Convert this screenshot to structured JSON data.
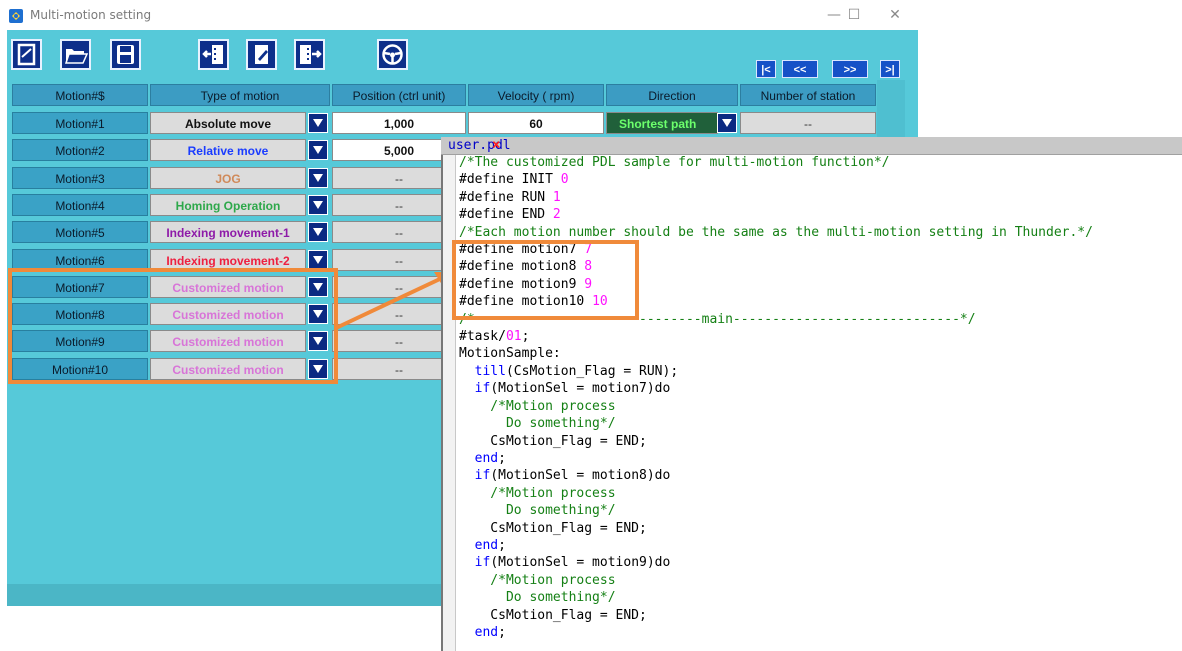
{
  "window": {
    "title": "Multi-motion setting",
    "controls": {
      "minimize": "—",
      "maximize": "☐",
      "close": "✕"
    }
  },
  "toolbar": {
    "icons": [
      "new-file-icon",
      "open-folder-icon",
      "save-icon",
      "import-icon",
      "edit-chip-icon",
      "export-icon",
      "steering-wheel-icon"
    ],
    "nav": {
      "first": "|<",
      "prev": "<<",
      "next": ">>",
      "last": ">|"
    }
  },
  "table": {
    "headers": [
      "Motion#$",
      "Type of motion",
      "Position (ctrl unit)",
      "Velocity ( rpm)",
      "Direction",
      "Number of station"
    ],
    "rows": [
      {
        "motion": "Motion#1",
        "type": "Absolute move",
        "type_color": "#111111",
        "position": "1,000",
        "velocity": "60",
        "direction": "Shortest path",
        "station": "--"
      },
      {
        "motion": "Motion#2",
        "type": "Relative move",
        "type_color": "#1a3cff",
        "position": "5,000"
      },
      {
        "motion": "Motion#3",
        "type": "JOG",
        "type_color": "#d08a5a",
        "position": "--"
      },
      {
        "motion": "Motion#4",
        "type": "Homing Operation",
        "type_color": "#2ea84a",
        "position": "--"
      },
      {
        "motion": "Motion#5",
        "type": "Indexing movement-1",
        "type_color": "#8e1aa8",
        "position": "--"
      },
      {
        "motion": "Motion#6",
        "type": "Indexing movement-2",
        "type_color": "#ee2040",
        "position": "--"
      },
      {
        "motion": "Motion#7",
        "type": "Customized motion",
        "type_color": "#d874d8",
        "position": "--"
      },
      {
        "motion": "Motion#8",
        "type": "Customized motion",
        "type_color": "#d874d8",
        "position": "--"
      },
      {
        "motion": "Motion#9",
        "type": "Customized motion",
        "type_color": "#d874d8",
        "position": "--"
      },
      {
        "motion": "Motion#10",
        "type": "Customized motion",
        "type_color": "#d874d8",
        "position": "--"
      }
    ]
  },
  "editor": {
    "tab_name": "user.pdl",
    "tab_close": "×",
    "lines": [
      [
        {
          "t": "/*The customized PDL sample for multi-motion function*/",
          "c": "cm"
        }
      ],
      [
        {
          "t": "#define INIT ",
          "c": "tx"
        },
        {
          "t": "0",
          "c": "nm"
        }
      ],
      [
        {
          "t": "#define RUN ",
          "c": "tx"
        },
        {
          "t": "1",
          "c": "nm"
        }
      ],
      [
        {
          "t": "#define END ",
          "c": "tx"
        },
        {
          "t": "2",
          "c": "nm"
        }
      ],
      [
        {
          "t": "/*Each motion number should be the same as the multi-motion setting in Thunder.*/",
          "c": "cm"
        }
      ],
      [
        {
          "t": "#define motion7 ",
          "c": "tx"
        },
        {
          "t": "7",
          "c": "nm"
        }
      ],
      [
        {
          "t": "#define motion8 ",
          "c": "tx"
        },
        {
          "t": "8",
          "c": "nm"
        }
      ],
      [
        {
          "t": "#define motion9 ",
          "c": "tx"
        },
        {
          "t": "9",
          "c": "nm"
        }
      ],
      [
        {
          "t": "#define motion10 ",
          "c": "tx"
        },
        {
          "t": "10",
          "c": "nm"
        }
      ],
      [
        {
          "t": "/*-----------------------------main-----------------------------*/",
          "c": "cm"
        }
      ],
      [
        {
          "t": "#task/",
          "c": "tx"
        },
        {
          "t": "01",
          "c": "nm"
        },
        {
          "t": ";",
          "c": "tx"
        }
      ],
      [
        {
          "t": "MotionSample:",
          "c": "tx"
        }
      ],
      [
        {
          "t": "  ",
          "c": "tx"
        },
        {
          "t": "till",
          "c": "kw"
        },
        {
          "t": "(CsMotion_Flag = RUN);",
          "c": "tx"
        }
      ],
      [
        {
          "t": "  ",
          "c": "tx"
        },
        {
          "t": "if",
          "c": "kw"
        },
        {
          "t": "(MotionSel = motion7)do",
          "c": "tx"
        }
      ],
      [
        {
          "t": "    /*Motion process",
          "c": "cm"
        }
      ],
      [
        {
          "t": "      Do something*/",
          "c": "cm"
        }
      ],
      [
        {
          "t": "    CsMotion_Flag = END;",
          "c": "tx"
        }
      ],
      [
        {
          "t": "  end",
          "c": "kw"
        },
        {
          "t": ";",
          "c": "tx"
        }
      ],
      [
        {
          "t": "  ",
          "c": "tx"
        },
        {
          "t": "if",
          "c": "kw"
        },
        {
          "t": "(MotionSel = motion8)do",
          "c": "tx"
        }
      ],
      [
        {
          "t": "    /*Motion process",
          "c": "cm"
        }
      ],
      [
        {
          "t": "      Do something*/",
          "c": "cm"
        }
      ],
      [
        {
          "t": "    CsMotion_Flag = END;",
          "c": "tx"
        }
      ],
      [
        {
          "t": "  end",
          "c": "kw"
        },
        {
          "t": ";",
          "c": "tx"
        }
      ],
      [
        {
          "t": "  ",
          "c": "tx"
        },
        {
          "t": "if",
          "c": "kw"
        },
        {
          "t": "(MotionSel = motion9)do",
          "c": "tx"
        }
      ],
      [
        {
          "t": "    /*Motion process",
          "c": "cm"
        }
      ],
      [
        {
          "t": "      Do something*/",
          "c": "cm"
        }
      ],
      [
        {
          "t": "    CsMotion_Flag = END;",
          "c": "tx"
        }
      ],
      [
        {
          "t": "  end",
          "c": "kw"
        },
        {
          "t": ";",
          "c": "tx"
        }
      ]
    ]
  },
  "colors": {
    "highlight": "#f08a3a",
    "panel": "#56c9d9",
    "header": "#3c9cc3",
    "dropdown": "#0b2a82"
  }
}
